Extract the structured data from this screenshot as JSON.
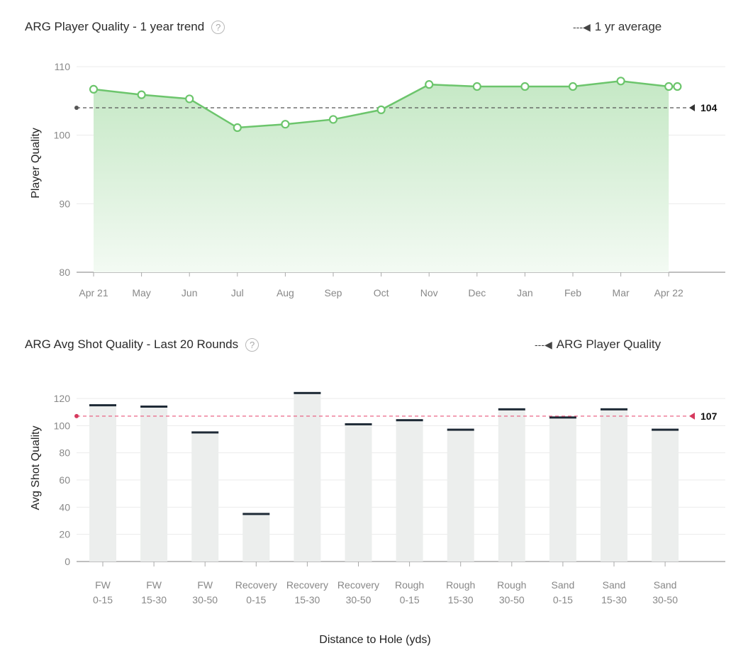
{
  "chart_data": [
    {
      "type": "line",
      "title": "ARG Player Quality - 1 year trend",
      "legend": {
        "label": "1 yr average",
        "symbol": "---◀",
        "position": "top-right"
      },
      "xlabel": "",
      "ylabel": "Player Quality",
      "ylim": [
        80,
        110
      ],
      "yticks": [
        80,
        90,
        100,
        110
      ],
      "categories": [
        "Apr 21",
        "May",
        "Jun",
        "Jul",
        "Aug",
        "Sep",
        "Oct",
        "Nov",
        "Dec",
        "Jan",
        "Feb",
        "Mar",
        "Apr 22"
      ],
      "series": [
        {
          "values": [
            106.7,
            105.9,
            105.3,
            101.1,
            101.6,
            102.3,
            103.7,
            107.4,
            107.1,
            107.1,
            107.1,
            107.9,
            107.1,
            107.1
          ]
        }
      ],
      "x_positions": [
        0,
        1,
        2,
        3,
        4,
        5,
        6,
        7,
        8,
        9,
        10,
        11,
        12,
        12.18
      ],
      "reference_line": {
        "value": 104,
        "label": "104",
        "style": "dashed"
      },
      "colors": {
        "line": "#6cc56c",
        "fill_top": "#c5e8c5",
        "fill_bottom": "#f3faf3",
        "reference": "#555555"
      },
      "grid": true
    },
    {
      "type": "bar",
      "title": "ARG Avg Shot Quality - Last 20 Rounds",
      "legend": {
        "label": "ARG Player Quality",
        "symbol": "---◀",
        "position": "top-right"
      },
      "xlabel": "Distance to Hole (yds)",
      "ylabel": "Avg Shot Quality",
      "ylim": [
        0,
        130
      ],
      "yticks": [
        0,
        20,
        40,
        60,
        80,
        100,
        120
      ],
      "categories": [
        [
          "FW",
          "0-15"
        ],
        [
          "FW",
          "15-30"
        ],
        [
          "FW",
          "30-50"
        ],
        [
          "Recovery",
          "0-15"
        ],
        [
          "Recovery",
          "15-30"
        ],
        [
          "Recovery",
          "30-50"
        ],
        [
          "Rough",
          "0-15"
        ],
        [
          "Rough",
          "15-30"
        ],
        [
          "Rough",
          "30-50"
        ],
        [
          "Sand",
          "0-15"
        ],
        [
          "Sand",
          "15-30"
        ],
        [
          "Sand",
          "30-50"
        ]
      ],
      "values": [
        115,
        114,
        95,
        35,
        124,
        101,
        104,
        97,
        112,
        106,
        112,
        97
      ],
      "reference_line": {
        "value": 107,
        "label": "107",
        "style": "dashed"
      },
      "colors": {
        "bar": "#eceeed",
        "bar_cap": "#1e2a36",
        "reference": "#e8557a",
        "reference_marker": "#d63a5e"
      },
      "grid": true
    }
  ]
}
